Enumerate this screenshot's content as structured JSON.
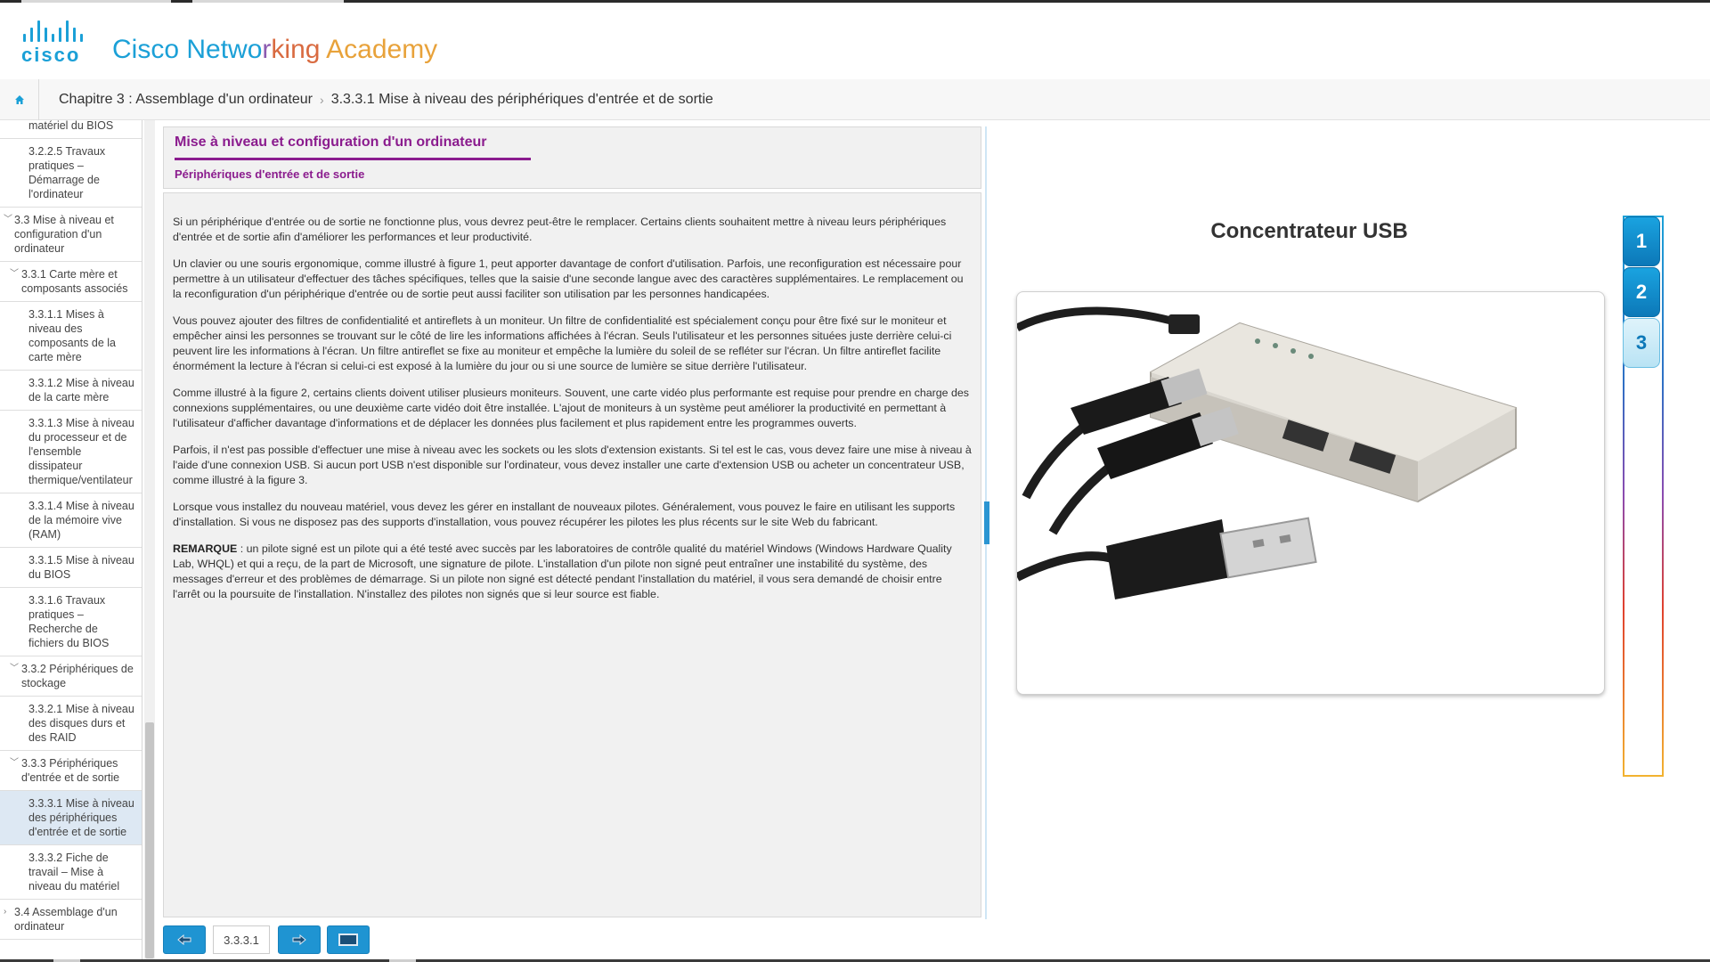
{
  "header": {
    "logo_word": "cisco",
    "academy_parts": [
      "Cisco ",
      "Netwo",
      "r",
      "king ",
      "Academy"
    ]
  },
  "breadcrumb": {
    "chapter": "Chapitre 3 : Assemblage d'un ordinateur",
    "separator": "›",
    "current": "3.3.3.1 Mise à niveau des périphériques d'entrée et de sortie"
  },
  "sidebar": {
    "items": [
      {
        "label": "matériel du BIOS",
        "level": 3
      },
      {
        "label": "3.2.2.5 Travaux pratiques – Démarrage de l'ordinateur",
        "level": 3
      },
      {
        "label": "3.3 Mise à niveau et configuration d'un ordinateur",
        "level": 1,
        "expanded": true
      },
      {
        "label": "3.3.1 Carte mère et composants associés",
        "level": 2,
        "expanded": true
      },
      {
        "label": "3.3.1.1 Mises à niveau des composants de la carte mère",
        "level": 3
      },
      {
        "label": "3.3.1.2 Mise à niveau de la carte mère",
        "level": 3
      },
      {
        "label": "3.3.1.3 Mise à niveau du processeur et de l'ensemble dissipateur thermique/ventilateur",
        "level": 3
      },
      {
        "label": "3.3.1.4 Mise à niveau de la mémoire vive (RAM)",
        "level": 3
      },
      {
        "label": "3.3.1.5 Mise à niveau du BIOS",
        "level": 3
      },
      {
        "label": "3.3.1.6 Travaux pratiques – Recherche de fichiers du BIOS",
        "level": 3
      },
      {
        "label": "3.3.2 Périphériques de stockage",
        "level": 2,
        "expanded": true
      },
      {
        "label": "3.3.2.1 Mise à niveau des disques durs et des RAID",
        "level": 3
      },
      {
        "label": "3.3.3 Périphériques d'entrée et de sortie",
        "level": 2,
        "expanded": true
      },
      {
        "label": "3.3.3.1 Mise à niveau des périphériques d'entrée et de sortie",
        "level": 3,
        "active": true
      },
      {
        "label": "3.3.3.2 Fiche de travail – Mise à niveau du matériel",
        "level": 3
      },
      {
        "label": "3.4 Assemblage d'un ordinateur",
        "level": 1,
        "expanded": false
      }
    ]
  },
  "content": {
    "title": "Mise à niveau et configuration d'un ordinateur",
    "subtitle": "Périphériques d'entrée et de sortie",
    "paragraphs": [
      "Si un périphérique d'entrée ou de sortie ne fonctionne plus, vous devrez peut-être le remplacer. Certains clients souhaitent mettre à niveau leurs périphériques d'entrée et de sortie afin d'améliorer les performances et leur productivité.",
      "Un clavier ou une souris ergonomique, comme illustré à figure 1, peut apporter davantage de confort d'utilisation. Parfois, une reconfiguration est nécessaire pour permettre à un utilisateur d'effectuer des tâches spécifiques, telles que la saisie d'une seconde langue avec des caractères supplémentaires. Le remplacement ou la reconfiguration d'un périphérique d'entrée ou de sortie peut aussi faciliter son utilisation par les personnes handicapées.",
      "Vous pouvez ajouter des filtres de confidentialité et antireflets à un moniteur. Un filtre de confidentialité est spécialement conçu pour être fixé sur le moniteur et empêcher ainsi les personnes se trouvant sur le côté de lire les informations affichées à l'écran. Seuls l'utilisateur et les personnes situées juste derrière celui-ci peuvent lire les informations à l'écran. Un filtre antireflet se fixe au moniteur et empêche la lumière du soleil de se refléter sur l'écran. Un filtre antireflet facilite énormément la lecture à l'écran si celui-ci est exposé à la lumière du jour ou si une source de lumière se situe derrière l'utilisateur.",
      "Comme illustré à la figure 2, certains clients doivent utiliser plusieurs moniteurs. Souvent, une carte vidéo plus performante est requise pour prendre en charge des connexions supplémentaires, ou une deuxième carte vidéo doit être installée. L'ajout de moniteurs à un système peut améliorer la productivité en permettant à l'utilisateur d'afficher davantage d'informations et de déplacer les données plus facilement et plus rapidement entre les programmes ouverts.",
      "Parfois, il n'est pas possible d'effectuer une mise à niveau avec les sockets ou les slots d'extension existants. Si tel est le cas, vous devez faire une mise à niveau à l'aide d'une connexion USB. Si aucun port USB n'est disponible sur l'ordinateur, vous devez installer une carte d'extension USB ou acheter un concentrateur USB, comme illustré à la figure 3.",
      "Lorsque vous installez du nouveau matériel, vous devez les gérer en installant de nouveaux pilotes. Généralement, vous pouvez le faire en utilisant les supports d'installation. Si vous ne disposez pas des supports d'installation, vous pouvez récupérer les pilotes les plus récents sur le site Web du fabricant."
    ],
    "note_label": "REMARQUE",
    "note_text": " : un pilote signé est un pilote qui a été testé avec succès par les laboratoires de contrôle qualité du matériel Windows (Windows Hardware Quality Lab, WHQL) et qui a reçu, de la part de Microsoft, une signature de pilote. L'installation d'un pilote non signé peut entraîner une instabilité du système, des messages d'erreur et des problèmes de démarrage. Si un pilote non signé est détecté pendant l'installation du matériel, il vous sera demandé de choisir entre l'arrêt ou la poursuite de l'installation. N'installez des pilotes non signés que si leur source est fiable."
  },
  "nav": {
    "page_number": "3.3.3.1"
  },
  "figure": {
    "title": "Concentrateur USB",
    "tabs": [
      "1",
      "2",
      "3"
    ],
    "active_tab": "3"
  },
  "colors": {
    "accent_blue": "#1ba0d7",
    "title_purple": "#8b1c8e"
  }
}
